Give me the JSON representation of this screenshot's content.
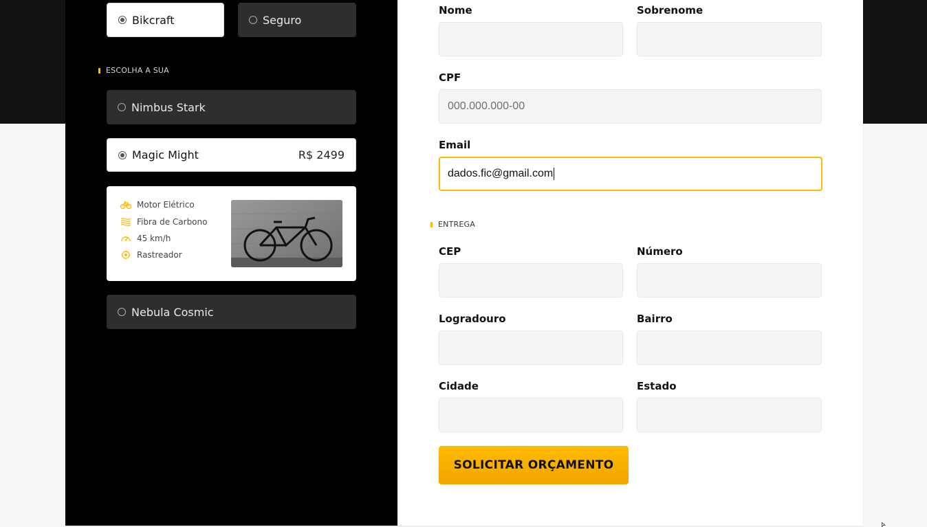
{
  "left": {
    "marca_options": [
      {
        "label": "Bikcraft",
        "selected": true
      },
      {
        "label": "Seguro",
        "selected": false
      }
    ],
    "choose_title": "ESCOLHA A SUA",
    "bikes": [
      {
        "label": "Nimbus Stark",
        "selected": false
      },
      {
        "label": "Magic Might",
        "selected": true,
        "price": "R$ 2499"
      },
      {
        "label": "Nebula Cosmic",
        "selected": false
      }
    ],
    "features": [
      {
        "icon": "bike-icon",
        "text": "Motor Elétrico"
      },
      {
        "icon": "carbon-fiber-icon",
        "text": "Fibra de Carbono"
      },
      {
        "icon": "speedometer-icon",
        "text": "45 km/h"
      },
      {
        "icon": "tracker-icon",
        "text": "Rastreador"
      }
    ]
  },
  "form": {
    "nome_label": "Nome",
    "sobrenome_label": "Sobrenome",
    "cpf_label": "CPF",
    "cpf_placeholder": "000.000.000-00",
    "email_label": "Email",
    "email_value": "dados.fic@gmail.com",
    "entrega_title": "ENTREGA",
    "cep_label": "CEP",
    "numero_label": "Número",
    "logradouro_label": "Logradouro",
    "bairro_label": "Bairro",
    "cidade_label": "Cidade",
    "estado_label": "Estado",
    "submit_label": "SOLICITAR ORÇAMENTO"
  },
  "colors": {
    "accent": "#ffbb00",
    "dark_panel": "#000000",
    "option_dark": "#2e2e2e",
    "field_bg": "#f5f5f5"
  }
}
